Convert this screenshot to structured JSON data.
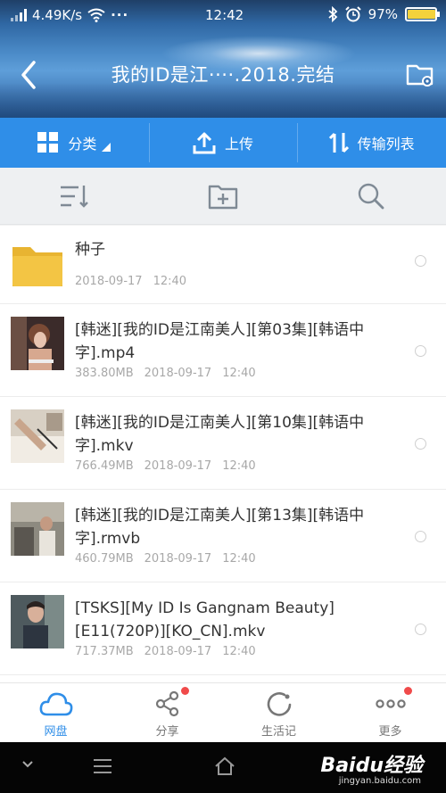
{
  "status_bar": {
    "net_speed": "4.49K/s",
    "dots": "···",
    "time": "12:42",
    "battery": "97%",
    "battery_level": 0.97
  },
  "header": {
    "title": "我的ID是江····.2018.完结"
  },
  "actions": [
    {
      "label": "分类"
    },
    {
      "label": "上传"
    },
    {
      "label": "传输列表"
    }
  ],
  "files": [
    {
      "name": "种子",
      "size": "",
      "date": "2018-09-17",
      "time": "12:40",
      "type": "folder"
    },
    {
      "name": "[韩迷][我的ID是江南美人][第03集][韩语中字].mp4",
      "size": "383.80MB",
      "date": "2018-09-17",
      "time": "12:40",
      "type": "video"
    },
    {
      "name": "[韩迷][我的ID是江南美人][第10集][韩语中字].mkv",
      "size": "766.49MB",
      "date": "2018-09-17",
      "time": "12:40",
      "type": "video"
    },
    {
      "name": "[韩迷][我的ID是江南美人][第13集][韩语中字].rmvb",
      "size": "460.79MB",
      "date": "2018-09-17",
      "time": "12:40",
      "type": "video"
    },
    {
      "name": "[TSKS][My ID Is Gangnam Beauty][E11(720P)][KO_CN].mkv",
      "size": "717.37MB",
      "date": "2018-09-17",
      "time": "12:40",
      "type": "video"
    }
  ],
  "tabs": [
    {
      "label": "网盘",
      "active": true
    },
    {
      "label": "分享",
      "badge": true
    },
    {
      "label": "生活记"
    },
    {
      "label": "更多",
      "badge": true
    }
  ],
  "watermark": {
    "brand": "Baidu经验",
    "url": "jingyan.baidu.com"
  },
  "colors": {
    "accent": "#2f8ee8",
    "badge": "#f04a4a",
    "folder": "#f3c544"
  }
}
